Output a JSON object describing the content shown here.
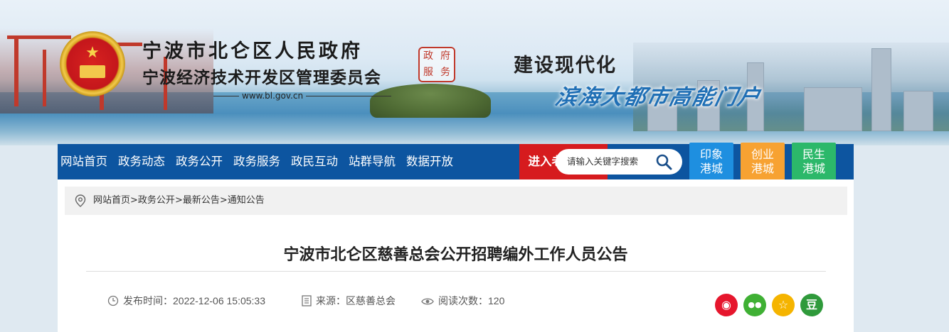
{
  "header": {
    "title_line1": "宁波市北仑区人民政府",
    "title_line2": "宁波经济技术开发区管理委员会",
    "url": "www.bl.gov.cn",
    "seal_chars": [
      "政",
      "府",
      "服",
      "务"
    ],
    "slogan_line1": "建设现代化",
    "slogan_line2": "滨海大都市高能门户"
  },
  "nav": {
    "items": [
      "网站首页",
      "政务动态",
      "政务公开",
      "政务服务",
      "政民互动",
      "站群导航",
      "数据开放"
    ],
    "elder_mode": "进入老年模式",
    "search_placeholder": "请输入关键字搜索",
    "quick_links": [
      {
        "line1": "印象",
        "line2": "港城",
        "color": "#1e8fe0"
      },
      {
        "line1": "创业",
        "line2": "港城",
        "color": "#f7a232"
      },
      {
        "line1": "民生",
        "line2": "港城",
        "color": "#2cb86a"
      }
    ]
  },
  "breadcrumb": {
    "items": [
      "网站首页",
      "政务公开",
      "最新公告",
      "通知公告"
    ],
    "separator": ">"
  },
  "article": {
    "title": "宁波市北仑区慈善总会公开招聘编外工作人员公告",
    "publish_label": "发布时间：",
    "publish_time": "2022-12-06 15:05:33",
    "source_label": "来源：",
    "source": "区慈善总会",
    "views_label": "阅读次数：",
    "views": "120"
  },
  "share": {
    "buttons": [
      {
        "icon": "weibo-icon",
        "glyph": "◉",
        "color": "#e6162d"
      },
      {
        "icon": "wechat-icon",
        "glyph": "●●",
        "color": "#3fb034"
      },
      {
        "icon": "qzone-icon",
        "glyph": "☆",
        "color": "#f5b400"
      },
      {
        "icon": "douban-icon",
        "glyph": "豆",
        "color": "#2f9a3b"
      }
    ]
  },
  "colors": {
    "nav_bg": "#0d55a0",
    "elder_bg": "#d61b1e",
    "page_bg": "#dfe9f1"
  }
}
